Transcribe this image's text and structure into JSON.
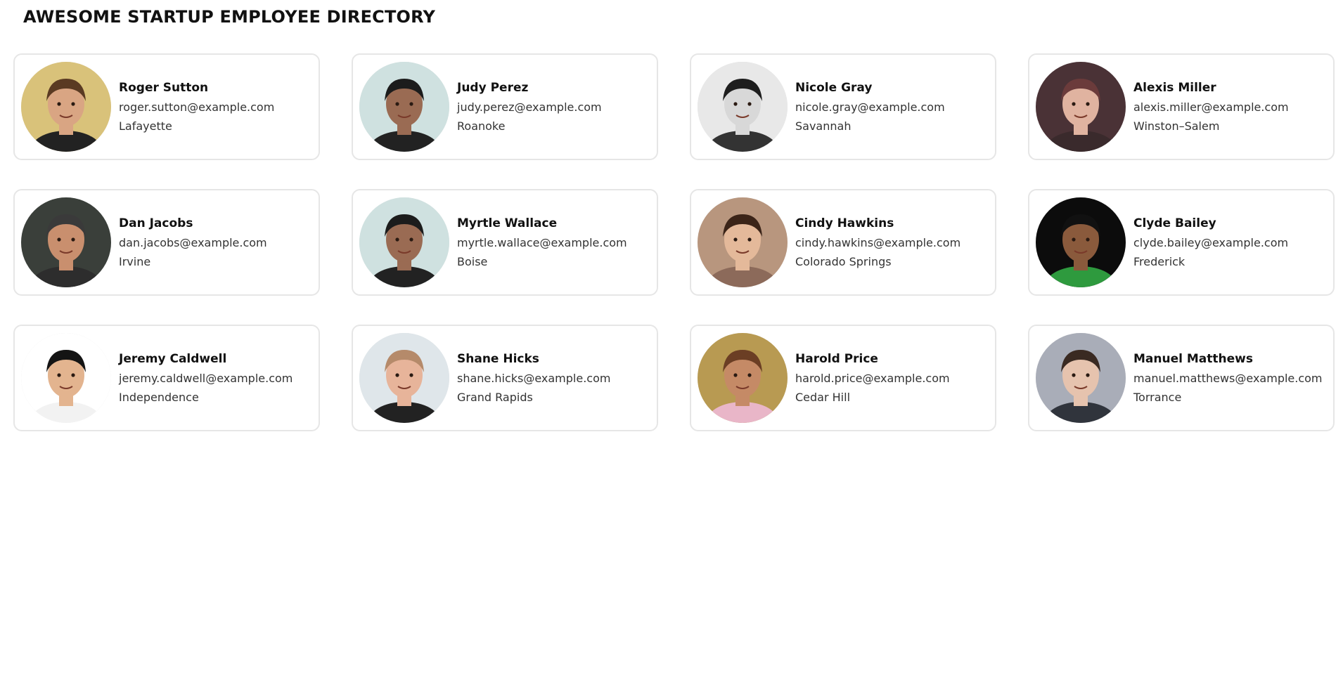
{
  "header": {
    "title": "AWESOME STARTUP EMPLOYEE DIRECTORY"
  },
  "employees": [
    {
      "name": "Roger Sutton",
      "email": "roger.sutton@example.com",
      "city": "Lafayette",
      "avatar": {
        "bg": "#d9c27a",
        "skin": "#d9a583",
        "hair": "#5a3a22",
        "shirt": "#222222"
      }
    },
    {
      "name": "Judy Perez",
      "email": "judy.perez@example.com",
      "city": "Roanoke",
      "avatar": {
        "bg": "#cfe1e0",
        "skin": "#9a6b53",
        "hair": "#1c1c1c",
        "shirt": "#222222"
      }
    },
    {
      "name": "Nicole Gray",
      "email": "nicole.gray@example.com",
      "city": "Savannah",
      "avatar": {
        "bg": "#e8e8e8",
        "skin": "#d8d8d8",
        "hair": "#1e1e1e",
        "shirt": "#333333"
      }
    },
    {
      "name": "Alexis Miller",
      "email": "alexis.miller@example.com",
      "city": "Winston–Salem",
      "avatar": {
        "bg": "#4a3236",
        "skin": "#e0b3a0",
        "hair": "#6b3b3b",
        "shirt": "#3a2a2c"
      }
    },
    {
      "name": "Dan Jacobs",
      "email": "dan.jacobs@example.com",
      "city": "Irvine",
      "avatar": {
        "bg": "#3a3f3a",
        "skin": "#c98f6e",
        "hair": "#3a3a3a",
        "shirt": "#2d2d2d"
      }
    },
    {
      "name": "Myrtle Wallace",
      "email": "myrtle.wallace@example.com",
      "city": "Boise",
      "avatar": {
        "bg": "#cfe1e0",
        "skin": "#9a6b53",
        "hair": "#1c1c1c",
        "shirt": "#222222"
      }
    },
    {
      "name": "Cindy Hawkins",
      "email": "cindy.hawkins@example.com",
      "city": "Colorado Springs",
      "avatar": {
        "bg": "#b8967e",
        "skin": "#e4b99a",
        "hair": "#3b2418",
        "shirt": "#8c6a5a"
      }
    },
    {
      "name": "Clyde Bailey",
      "email": "clyde.bailey@example.com",
      "city": "Frederick",
      "avatar": {
        "bg": "#0c0c0c",
        "skin": "#8a5a3c",
        "hair": "#111111",
        "shirt": "#2e9a3e"
      }
    },
    {
      "name": "Jeremy Caldwell",
      "email": "jeremy.caldwell@example.com",
      "city": "Independence",
      "avatar": {
        "bg": "#ffffff",
        "skin": "#e3b48f",
        "hair": "#141414",
        "shirt": "#f2f2f2"
      }
    },
    {
      "name": "Shane Hicks",
      "email": "shane.hicks@example.com",
      "city": "Grand Rapids",
      "avatar": {
        "bg": "#dfe6ea",
        "skin": "#e7b49a",
        "hair": "#b58a6a",
        "shirt": "#222222"
      }
    },
    {
      "name": "Harold Price",
      "email": "harold.price@example.com",
      "city": "Cedar Hill",
      "avatar": {
        "bg": "#b89a52",
        "skin": "#c58a66",
        "hair": "#6b3e24",
        "shirt": "#e9b6c8"
      }
    },
    {
      "name": "Manuel Matthews",
      "email": "manuel.matthews@example.com",
      "city": "Torrance",
      "avatar": {
        "bg": "#a9adb8",
        "skin": "#e6c3ae",
        "hair": "#3a2a22",
        "shirt": "#30343c"
      }
    }
  ]
}
